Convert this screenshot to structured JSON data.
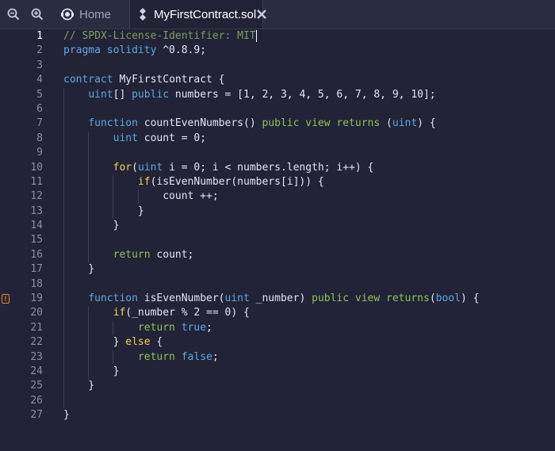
{
  "tabs": {
    "home_label": "Home",
    "file_label": "MyFirstContract.sol"
  },
  "icons": {
    "zoom_out": "zoom-out-icon",
    "zoom_in": "zoom-in-icon",
    "home": "remix-home-icon",
    "file": "solidity-file-icon",
    "close": "close-icon",
    "warning": "warning-icon"
  },
  "colors": {
    "background": "#222336",
    "tabbar": "#2a2c3f",
    "comment": "#7e9c62",
    "keyword": "#5fa6e2",
    "modifier": "#8ec05e",
    "control": "#f0d25a",
    "warning": "#e0883a"
  },
  "editor": {
    "current_line": 1,
    "warning_line": 19,
    "lines": [
      {
        "n": "1",
        "tokens": [
          {
            "t": "// SPDX-License-Identifier: MIT",
            "c": "comment"
          }
        ]
      },
      {
        "n": "2",
        "tokens": [
          {
            "t": "pragma solidity",
            "c": "kw"
          },
          {
            "t": " ^0.8.9;",
            "c": "plain"
          }
        ]
      },
      {
        "n": "3",
        "tokens": []
      },
      {
        "n": "4",
        "tokens": [
          {
            "t": "contract",
            "c": "kw"
          },
          {
            "t": " MyFirstContract {",
            "c": "plain"
          }
        ]
      },
      {
        "n": "5",
        "tokens": [
          {
            "t": "    ",
            "c": "plain"
          },
          {
            "t": "uint",
            "c": "kw"
          },
          {
            "t": "[] ",
            "c": "plain"
          },
          {
            "t": "public",
            "c": "kw"
          },
          {
            "t": " numbers = [1, 2, 3, 4, 5, 6, 7, 8, 9, 10];",
            "c": "plain"
          }
        ]
      },
      {
        "n": "6",
        "tokens": []
      },
      {
        "n": "7",
        "tokens": [
          {
            "t": "    ",
            "c": "plain"
          },
          {
            "t": "function",
            "c": "kw"
          },
          {
            "t": " countEvenNumbers() ",
            "c": "plain"
          },
          {
            "t": "public view returns",
            "c": "mod"
          },
          {
            "t": " (",
            "c": "plain"
          },
          {
            "t": "uint",
            "c": "kw"
          },
          {
            "t": ") {",
            "c": "plain"
          }
        ]
      },
      {
        "n": "8",
        "tokens": [
          {
            "t": "        ",
            "c": "plain"
          },
          {
            "t": "uint",
            "c": "kw"
          },
          {
            "t": " count = 0;",
            "c": "plain"
          }
        ]
      },
      {
        "n": "9",
        "tokens": []
      },
      {
        "n": "10",
        "tokens": [
          {
            "t": "        ",
            "c": "plain"
          },
          {
            "t": "for",
            "c": "ctrl"
          },
          {
            "t": "(",
            "c": "plain"
          },
          {
            "t": "uint",
            "c": "kw"
          },
          {
            "t": " i = 0; i < numbers.length; i++) {",
            "c": "plain"
          }
        ]
      },
      {
        "n": "11",
        "tokens": [
          {
            "t": "            ",
            "c": "plain"
          },
          {
            "t": "if",
            "c": "ctrl"
          },
          {
            "t": "(isEvenNumber(numbers[i])) {",
            "c": "plain"
          }
        ]
      },
      {
        "n": "12",
        "tokens": [
          {
            "t": "                count ++;",
            "c": "plain"
          }
        ]
      },
      {
        "n": "13",
        "tokens": [
          {
            "t": "            }",
            "c": "plain"
          }
        ]
      },
      {
        "n": "14",
        "tokens": [
          {
            "t": "        }",
            "c": "plain"
          }
        ]
      },
      {
        "n": "15",
        "tokens": []
      },
      {
        "n": "16",
        "tokens": [
          {
            "t": "        ",
            "c": "plain"
          },
          {
            "t": "return",
            "c": "mod"
          },
          {
            "t": " count;",
            "c": "plain"
          }
        ]
      },
      {
        "n": "17",
        "tokens": [
          {
            "t": "    }",
            "c": "plain"
          }
        ]
      },
      {
        "n": "18",
        "tokens": []
      },
      {
        "n": "19",
        "tokens": [
          {
            "t": "    ",
            "c": "plain"
          },
          {
            "t": "function",
            "c": "kw"
          },
          {
            "t": " isEvenNumber(",
            "c": "plain"
          },
          {
            "t": "uint",
            "c": "kw"
          },
          {
            "t": " _number) ",
            "c": "plain"
          },
          {
            "t": "public view returns",
            "c": "mod"
          },
          {
            "t": "(",
            "c": "plain"
          },
          {
            "t": "bool",
            "c": "kw"
          },
          {
            "t": ") {",
            "c": "plain"
          }
        ]
      },
      {
        "n": "20",
        "tokens": [
          {
            "t": "        ",
            "c": "plain"
          },
          {
            "t": "if",
            "c": "ctrl"
          },
          {
            "t": "(_number % 2 == 0) {",
            "c": "plain"
          }
        ]
      },
      {
        "n": "21",
        "tokens": [
          {
            "t": "            ",
            "c": "plain"
          },
          {
            "t": "return",
            "c": "mod"
          },
          {
            "t": " ",
            "c": "plain"
          },
          {
            "t": "true",
            "c": "kw"
          },
          {
            "t": ";",
            "c": "plain"
          }
        ]
      },
      {
        "n": "22",
        "tokens": [
          {
            "t": "        } ",
            "c": "plain"
          },
          {
            "t": "else",
            "c": "ctrl"
          },
          {
            "t": " {",
            "c": "plain"
          }
        ]
      },
      {
        "n": "23",
        "tokens": [
          {
            "t": "            ",
            "c": "plain"
          },
          {
            "t": "return",
            "c": "mod"
          },
          {
            "t": " ",
            "c": "plain"
          },
          {
            "t": "false",
            "c": "kw"
          },
          {
            "t": ";",
            "c": "plain"
          }
        ]
      },
      {
        "n": "24",
        "tokens": [
          {
            "t": "        }",
            "c": "plain"
          }
        ]
      },
      {
        "n": "25",
        "tokens": [
          {
            "t": "    }",
            "c": "plain"
          }
        ]
      },
      {
        "n": "26",
        "tokens": []
      },
      {
        "n": "27",
        "tokens": [
          {
            "t": "}",
            "c": "plain"
          }
        ]
      }
    ]
  }
}
